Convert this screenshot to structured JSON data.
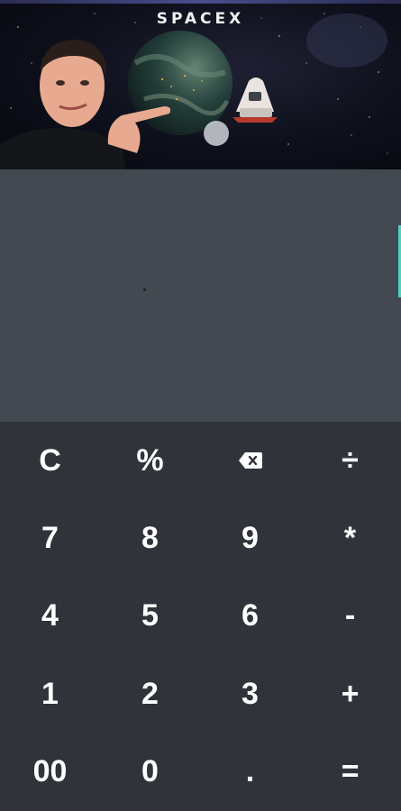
{
  "header": {
    "brand": "SPACEX"
  },
  "display": {
    "value": ""
  },
  "keypad": {
    "rows": [
      [
        {
          "name": "clear-button",
          "label": "C"
        },
        {
          "name": "percent-button",
          "label": "%"
        },
        {
          "name": "backspace-button",
          "icon": "backspace-icon"
        },
        {
          "name": "divide-button",
          "label": "÷"
        }
      ],
      [
        {
          "name": "digit-7-button",
          "label": "7"
        },
        {
          "name": "digit-8-button",
          "label": "8"
        },
        {
          "name": "digit-9-button",
          "label": "9"
        },
        {
          "name": "multiply-button",
          "label": "*"
        }
      ],
      [
        {
          "name": "digit-4-button",
          "label": "4"
        },
        {
          "name": "digit-5-button",
          "label": "5"
        },
        {
          "name": "digit-6-button",
          "label": "6"
        },
        {
          "name": "minus-button",
          "label": "-"
        }
      ],
      [
        {
          "name": "digit-1-button",
          "label": "1"
        },
        {
          "name": "digit-2-button",
          "label": "2"
        },
        {
          "name": "digit-3-button",
          "label": "3"
        },
        {
          "name": "plus-button",
          "label": "+"
        }
      ],
      [
        {
          "name": "double-zero-button",
          "label": "00"
        },
        {
          "name": "digit-0-button",
          "label": "0"
        },
        {
          "name": "decimal-point-button",
          "label": "."
        },
        {
          "name": "equals-button",
          "label": "="
        }
      ]
    ]
  },
  "colors": {
    "banner_bg": "#0d0f1a",
    "display_bg": "#424950",
    "keypad_bg": "#30343a",
    "key_text": "#ffffff",
    "accent": "#4fd1c5"
  }
}
